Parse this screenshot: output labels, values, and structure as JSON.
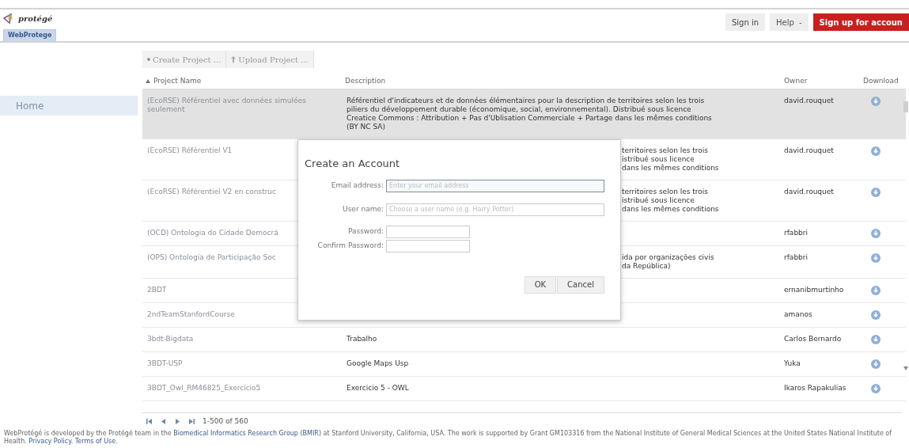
{
  "header": {
    "logo": "protégé",
    "tab": {
      "label": "WebProtege",
      "selected": true
    },
    "buttons": [
      {
        "label": "Sign in",
        "kind": "plain"
      },
      {
        "label": "Help",
        "kind": "menu",
        "caret": "-"
      },
      {
        "label": "Sign up for accoun",
        "kind": "primary"
      }
    ]
  },
  "sidebar": {
    "items": [
      {
        "label": "Home",
        "selected": true
      }
    ]
  },
  "toolbar": [
    {
      "label": "Create Project ...",
      "kind": "create"
    },
    {
      "label": "Upload Project ...",
      "kind": "upload"
    }
  ],
  "table": {
    "columns": [
      {
        "label": "Project Name",
        "sorted": true
      },
      {
        "label": "Description",
        "sorted": false
      },
      {
        "label": "Owner",
        "sorted": false
      },
      {
        "label": "Download",
        "sorted": false
      }
    ],
    "rows": [
      {
        "name": "(EcoRSE) Référentiel avec données simulées seulement",
        "description": [
          "Référentiel d'indicateurs et de données élémentaires pour la description de territoires selon les trois piliers du développement durable (économique, social, environnemental). Distribué sous licence Creatice Commons : Attribution + Pas d'Ublisation Commerciale + Partage dans les mêmes conditions (BY NC SA)"
        ],
        "partial": false,
        "owner": "david.rouquet",
        "selected": true
      },
      {
        "name": "(EcoRSE) Référentiel V1",
        "description": [
          "territoires selon les trois",
          "istribué sous licence",
          "dans les mêmes conditions"
        ],
        "partial": true,
        "owner": "david.rouquet",
        "selected": false
      },
      {
        "name": "(EcoRSE) Référentiel V2 en construc",
        "description": [
          "territoires selon les trois",
          "istribué sous licence",
          "dans les mêmes conditions"
        ],
        "partial": true,
        "owner": "david.rouquet",
        "selected": false
      },
      {
        "name": "(OCD) Ontologia do Cidade Democrá",
        "description": [],
        "owner": "rfabbri",
        "selected": false
      },
      {
        "name": "(OPS) Ontologia de Participação Soc",
        "description": [
          "ida por organizações civis",
          "da República)"
        ],
        "partial": true,
        "owner": "rfabbri",
        "selected": false
      },
      {
        "name": "2BDT",
        "description": [],
        "owner": "ernanibmurtinho",
        "selected": false
      },
      {
        "name": "2ndTeamStanfordCourse",
        "description": [],
        "owner": "amanos",
        "selected": false
      },
      {
        "name": "3bdt-Bigdata",
        "description": [
          "Trabalho"
        ],
        "partial": false,
        "owner": "Carlos Bernardo",
        "selected": false
      },
      {
        "name": "3BDT-USP",
        "description": [
          "Google Maps Usp"
        ],
        "partial": false,
        "owner": "Yuka",
        "selected": false
      },
      {
        "name": "3BDT_Owl_RM46825_Exercicio5",
        "description": [
          "Exercicio 5 - OWL"
        ],
        "partial": false,
        "owner": "Ikaros Rapakulias",
        "selected": false
      }
    ]
  },
  "pager": {
    "range": "1-500 of 560"
  },
  "footer": [
    {
      "text": "WebProtégé is developed by the Protégé team in the ",
      "kind": "text"
    },
    {
      "text": "Biomedical Informatics Research Group (BMIR)",
      "kind": "link"
    },
    {
      "text": " at Stanford University, California, USA. The work is supported by Grant GM103316 from the National Institute of General Medical Sciences at the United States National Institute of Health. ",
      "kind": "text"
    },
    {
      "text": "Privacy Policy",
      "kind": "link"
    },
    {
      "text": ". ",
      "kind": "text"
    },
    {
      "text": "Terms of Use",
      "kind": "link"
    },
    {
      "text": ".",
      "kind": "text"
    }
  ],
  "dialog": {
    "title": "Create an Account",
    "fields": [
      {
        "label": "Email address:",
        "placeholder": "Enter your email address",
        "kind": "wide",
        "focused": true
      },
      {
        "label": "User name:",
        "placeholder": "Choose a user name (e.g. Harry Potter)",
        "kind": "wide",
        "focused": false
      },
      {
        "label": "Password:",
        "kind": "short",
        "focused": false
      },
      {
        "label": "Confirm Password:",
        "kind": "short",
        "focused": false
      }
    ],
    "buttons": [
      "OK",
      "Cancel"
    ]
  }
}
